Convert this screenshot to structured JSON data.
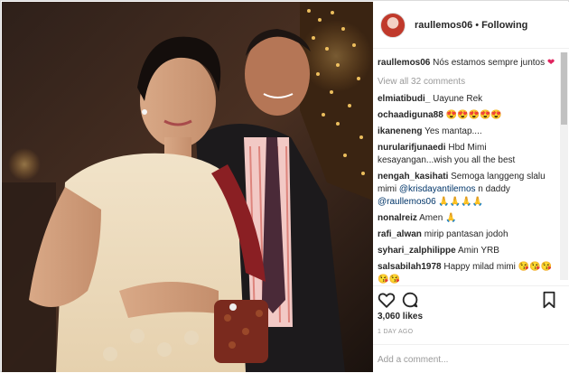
{
  "post": {
    "username": "raullemos06",
    "follow_label": "Following",
    "separator": "•"
  },
  "caption": {
    "username": "raullemos06",
    "text": "Nós estamos sempre juntos",
    "emoji": "❤"
  },
  "view_all": "View all 32 comments",
  "comments": [
    {
      "user": "elmiatibudi_",
      "text": "Uayune Rek"
    },
    {
      "user": "ochaadiguna88",
      "text": "😍😍😍😍😍"
    },
    {
      "user": "ikaneneng",
      "text": "Yes mantap...."
    },
    {
      "user": "nurularifjunaedi",
      "text": "Hbd Mimi kesayangan...wish you all the best"
    },
    {
      "user": "nengah_kasihati",
      "text": "Semoga langgeng slalu mimi",
      "mention1": "@krisdayantilemos",
      "mid": "n daddy",
      "mention2": "@raullemos06",
      "tail": "🙏🙏🙏🙏"
    },
    {
      "user": "nonalreiz",
      "text": "Amen 🙏"
    },
    {
      "user": "rafi_alwan",
      "text": "mirip pantasan jodoh"
    },
    {
      "user": "syhari_zalphilippe",
      "text": "Amin YRB"
    },
    {
      "user": "salsabilah1978",
      "text": "Happy milad mimi 😘😘😘😘😘"
    }
  ],
  "likes": "3,060 likes",
  "time_ago": "1 DAY AGO",
  "comment_input": {
    "placeholder": "Add a comment..."
  },
  "icons": {
    "like": "heart-icon",
    "comment": "comment-bubble-icon",
    "save": "bookmark-icon"
  },
  "colors": {
    "link": "#003569",
    "muted": "#999999",
    "text": "#262626",
    "border": "#dbdbdb"
  }
}
